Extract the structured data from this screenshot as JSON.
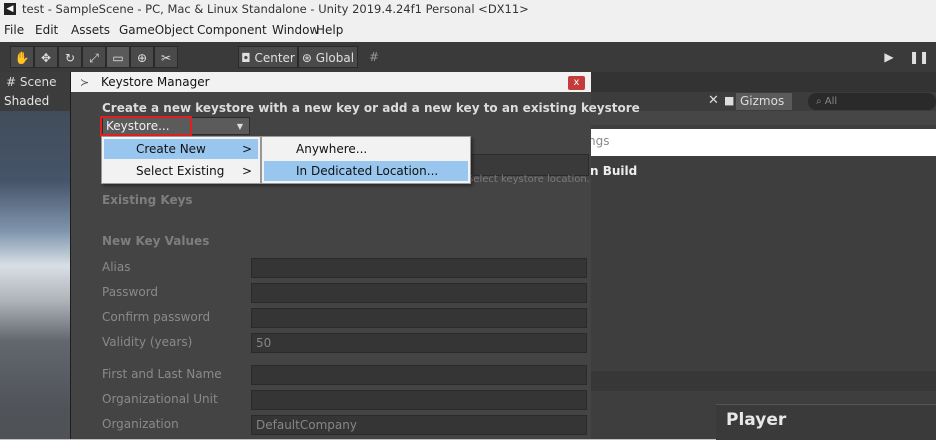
{
  "app": {
    "window_title": "test - SampleScene - PC, Mac & Linux Standalone - Unity 2019.4.24f1 Personal <DX11>",
    "logo_icon": "unity-logo-icon"
  },
  "menubar": {
    "items": [
      "File",
      "Edit",
      "Assets",
      "GameObject",
      "Component",
      "Window",
      "Help"
    ]
  },
  "toolbar": {
    "tools": [
      "hand-tool-icon",
      "move-tool-icon",
      "rotate-tool-icon",
      "scale-tool-icon",
      "rect-tool-icon",
      "transform-tool-icon",
      "custom-tool-icon"
    ],
    "pivot_label": "Center",
    "space_label": "Global",
    "snap_icon": "grid-snap-icon",
    "play_icon": "play-icon",
    "pause_icon": "pause-icon"
  },
  "scene": {
    "tab_label": "# Scene",
    "shading_mode": "Shaded",
    "gizmos_label": "Gizmos",
    "search_placeholder": "All"
  },
  "background_panel": {
    "strip_text": "ngs",
    "build_label": "n Build",
    "player_title": "Player"
  },
  "keystore_window": {
    "title": "Keystore Manager",
    "close_label": "x",
    "heading": "Create a new keystore with a new key or add a new key to an existing keystore",
    "dropdown_label": "Keystore...",
    "select_location_hint": "Select keystore location.",
    "existing_keys_label": "Existing Keys",
    "new_key_values_label": "New Key Values",
    "fields": [
      {
        "label": "Alias",
        "value": ""
      },
      {
        "label": "Password",
        "value": ""
      },
      {
        "label": "Confirm password",
        "value": ""
      },
      {
        "label": "Validity (years)",
        "value": "50"
      },
      {
        "label": "First and Last Name",
        "value": ""
      },
      {
        "label": "Organizational Unit",
        "value": ""
      },
      {
        "label": "Organization",
        "value": "DefaultCompany"
      }
    ]
  },
  "dropdown_menu": {
    "items": [
      {
        "label": "Create New",
        "arrow": ">",
        "highlighted": true
      },
      {
        "label": "Select Existing",
        "arrow": ">",
        "highlighted": false
      }
    ]
  },
  "submenu": {
    "items": [
      {
        "label": "Anywhere...",
        "highlighted": false
      },
      {
        "label": "In Dedicated Location...",
        "highlighted": true
      }
    ]
  },
  "colors": {
    "highlight": "#98c6ee",
    "close_button": "#c43b3b",
    "annotation_box": "#e02020"
  }
}
